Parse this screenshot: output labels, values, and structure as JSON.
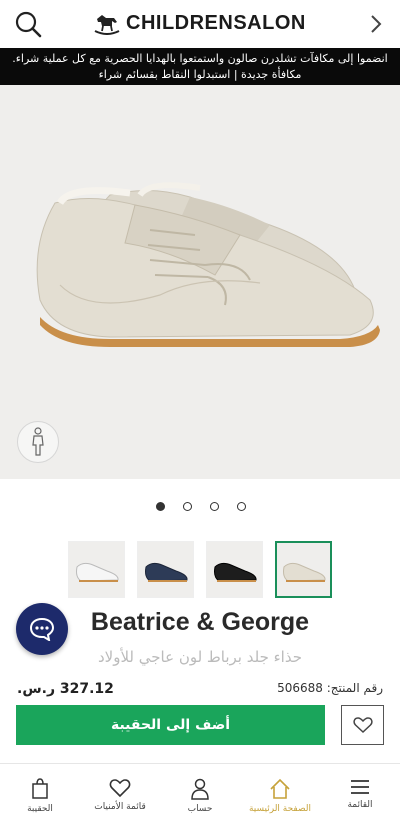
{
  "header": {
    "logo_text": "CHILDRENSALON",
    "search_icon": "search-icon",
    "back_icon": "chevron-right-icon"
  },
  "promo": {
    "line1": "انضموا إلى مكافآت تشلدرن صالون واستمتعوا بالهدايا الحصرية مع كل عملية شراء.",
    "line2": "مكافأة جديدة | استبدلوا النقاط بقسائم شراء"
  },
  "gallery": {
    "dot_count": 4,
    "active_dot": 1,
    "thumbnails": [
      "white",
      "navy",
      "black",
      "ivory"
    ],
    "selected_thumbnail": 4
  },
  "product": {
    "brand": "Beatrice & George",
    "title": "حذاء جلد برباط لون عاجي للأولاد",
    "price": "327.12 ر.س.",
    "code_label": "رقم المنتج: 506688"
  },
  "actions": {
    "add_to_bag": "أضف إلى الحقيبة"
  },
  "bottom_nav": {
    "items": [
      {
        "label": "الحقيبة",
        "icon": "bag-icon"
      },
      {
        "label": "قائمة الأمنيات",
        "icon": "heart-icon"
      },
      {
        "label": "حساب",
        "icon": "user-icon"
      },
      {
        "label": "الصفحة الرئيسية",
        "icon": "home-icon"
      },
      {
        "label": "القائمة",
        "icon": "menu-icon"
      }
    ],
    "active_index": 3
  },
  "colors": {
    "accent_green": "#1aa55b",
    "chat_navy": "#1d2a6b",
    "active_gold": "#c6a23a"
  }
}
